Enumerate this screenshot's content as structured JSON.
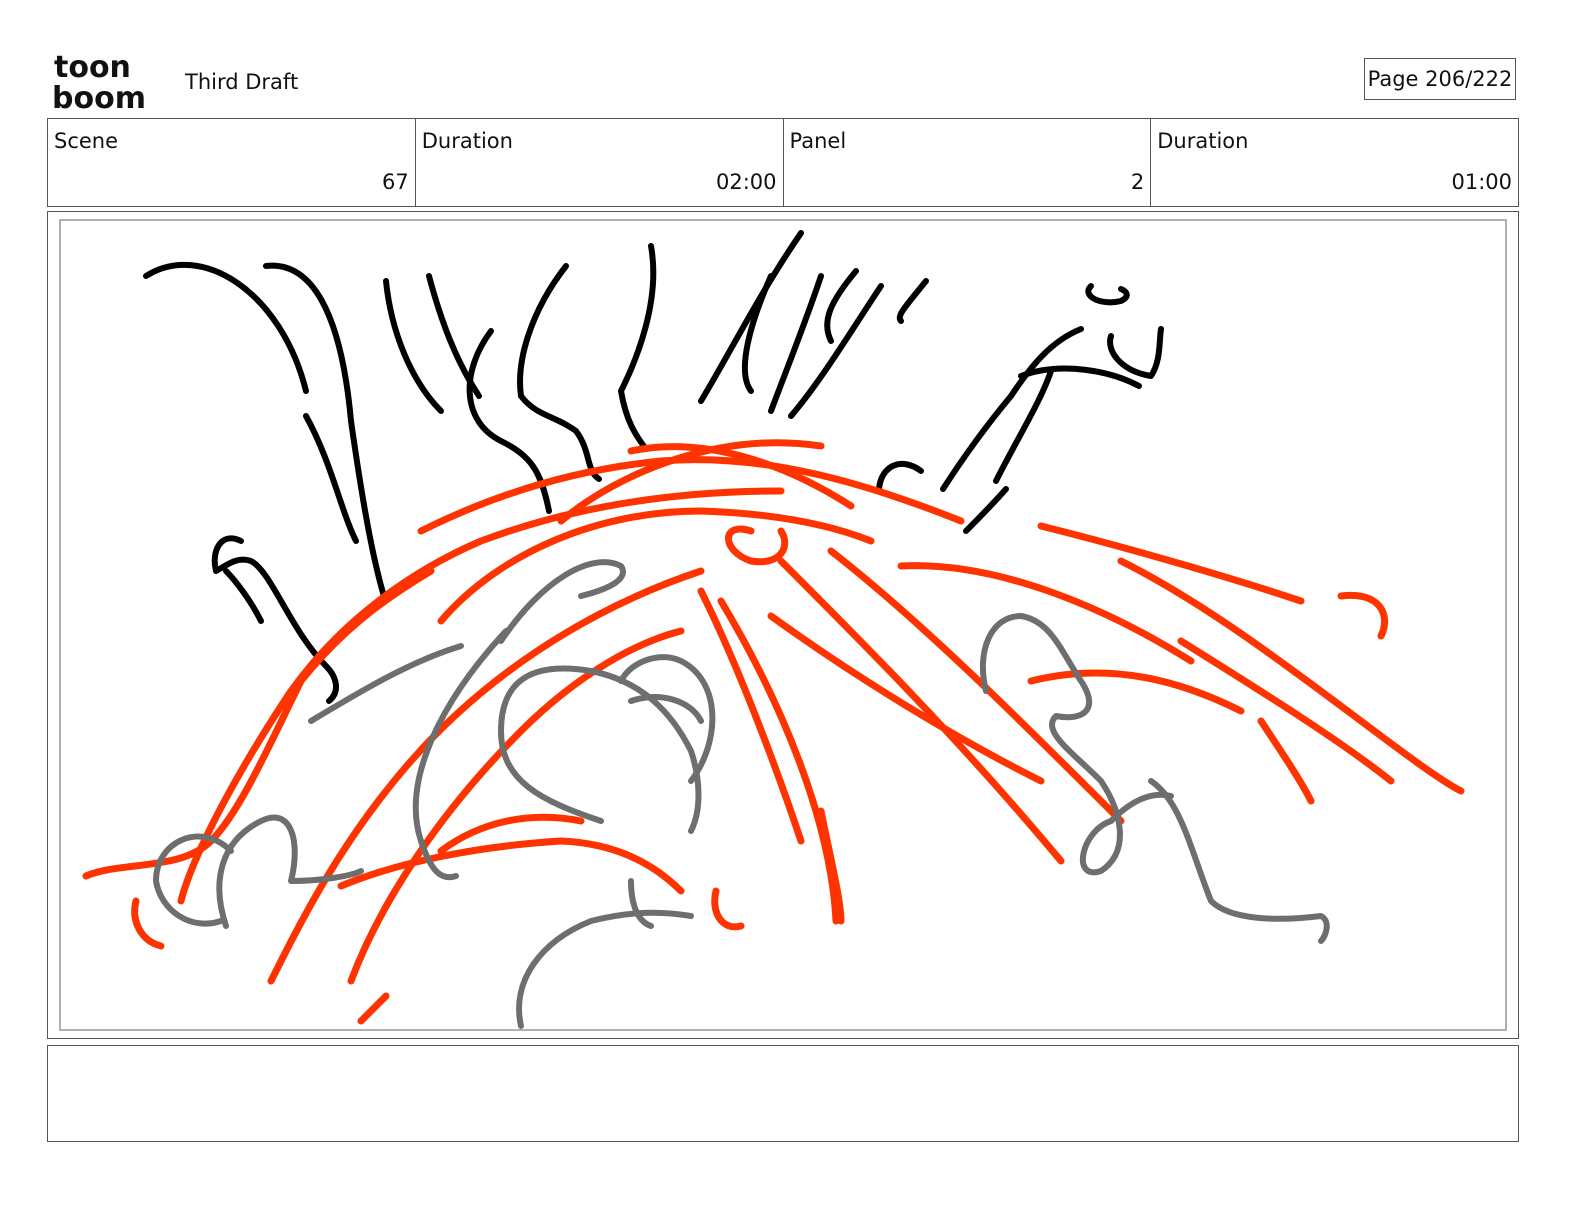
{
  "header": {
    "logo_top": "toon",
    "logo_bottom": "boom",
    "title": "Third Draft",
    "page": "Page 206/222"
  },
  "info": [
    {
      "label": "Scene",
      "value": "67"
    },
    {
      "label": "Duration",
      "value": "02:00"
    },
    {
      "label": "Panel",
      "value": "2"
    },
    {
      "label": "Duration",
      "value": "01:00"
    }
  ],
  "notes": "",
  "sketch": {
    "ink_colors": {
      "black": "#000000",
      "red": "#ff3300",
      "gray": "#6e6e6e"
    },
    "icon": "sketch-illustration"
  }
}
